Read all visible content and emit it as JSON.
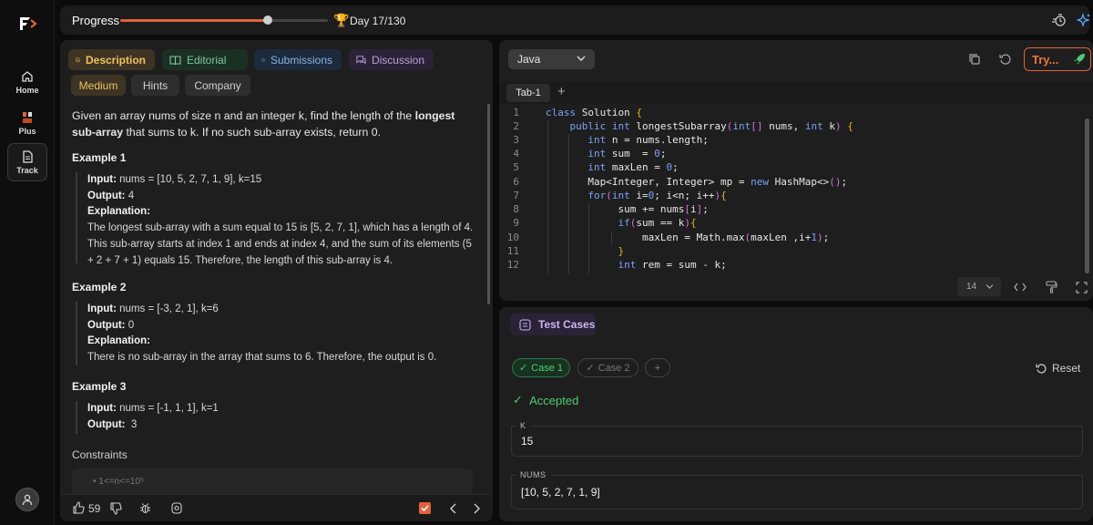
{
  "topbar": {
    "progress_label": "Progress",
    "progress_fraction": 0.71,
    "day_label": "Day 17/130"
  },
  "sidebar": {
    "items": [
      {
        "label": "Home"
      },
      {
        "label": "Plus"
      },
      {
        "label": "Track"
      }
    ]
  },
  "description": {
    "tabs": [
      "Description",
      "Editorial",
      "Submissions",
      "Discussion"
    ],
    "chips": [
      "Medium",
      "Hints",
      "Company"
    ],
    "problem_pre": "Given an array nums of size n and an integer k, find the length of the ",
    "problem_bold": "longest sub-array",
    "problem_post": " that sums to k. If no such sub-array exists, return 0.",
    "examples": [
      {
        "title": "Example 1",
        "input": "nums = [10, 5, 2, 7, 1, 9],  k=15",
        "output": "4",
        "explanation": "The longest sub-array with a sum equal to 15 is [5, 2, 7, 1], which has a length of 4. This sub-array starts at index 1 and ends at index 4, and the sum of its elements (5 + 2 + 7 + 1) equals 15. Therefore, the length of this sub-array is 4."
      },
      {
        "title": "Example 2",
        "input": "nums = [-3, 2, 1], k=6",
        "output": "0",
        "explanation": "There is no sub-array in the array that sums to 6. Therefore, the output is 0."
      },
      {
        "title": "Example 3",
        "input": "nums = [-1, 1, 1], k=1",
        "output": "3"
      }
    ],
    "labels": {
      "input": "Input:",
      "output": "Output:",
      "explanation": "Explanation:"
    },
    "constraints_title": "Constraints",
    "constraint_1": "1<=n<=10⁵",
    "likes": "59"
  },
  "editor": {
    "language": "Java",
    "try_label": "Try...",
    "tab_label": "Tab-1",
    "font_size": "14",
    "line_numbers": [
      "1",
      "2",
      "3",
      "4",
      "5",
      "6",
      "7",
      "8",
      "9",
      "10",
      "11",
      "12"
    ]
  },
  "tests": {
    "title": "Test Cases",
    "cases": [
      "Case 1",
      "Case 2"
    ],
    "add_label": "+",
    "reset_label": "Reset",
    "status": "Accepted",
    "inputs": [
      {
        "label": "K",
        "value": "15"
      },
      {
        "label": "NUMS",
        "value": "[10, 5, 2, 7, 1, 9]"
      }
    ]
  },
  "colors": {
    "accent": "#e0623a",
    "success": "#4ecb71",
    "medium": "#f0c060"
  }
}
